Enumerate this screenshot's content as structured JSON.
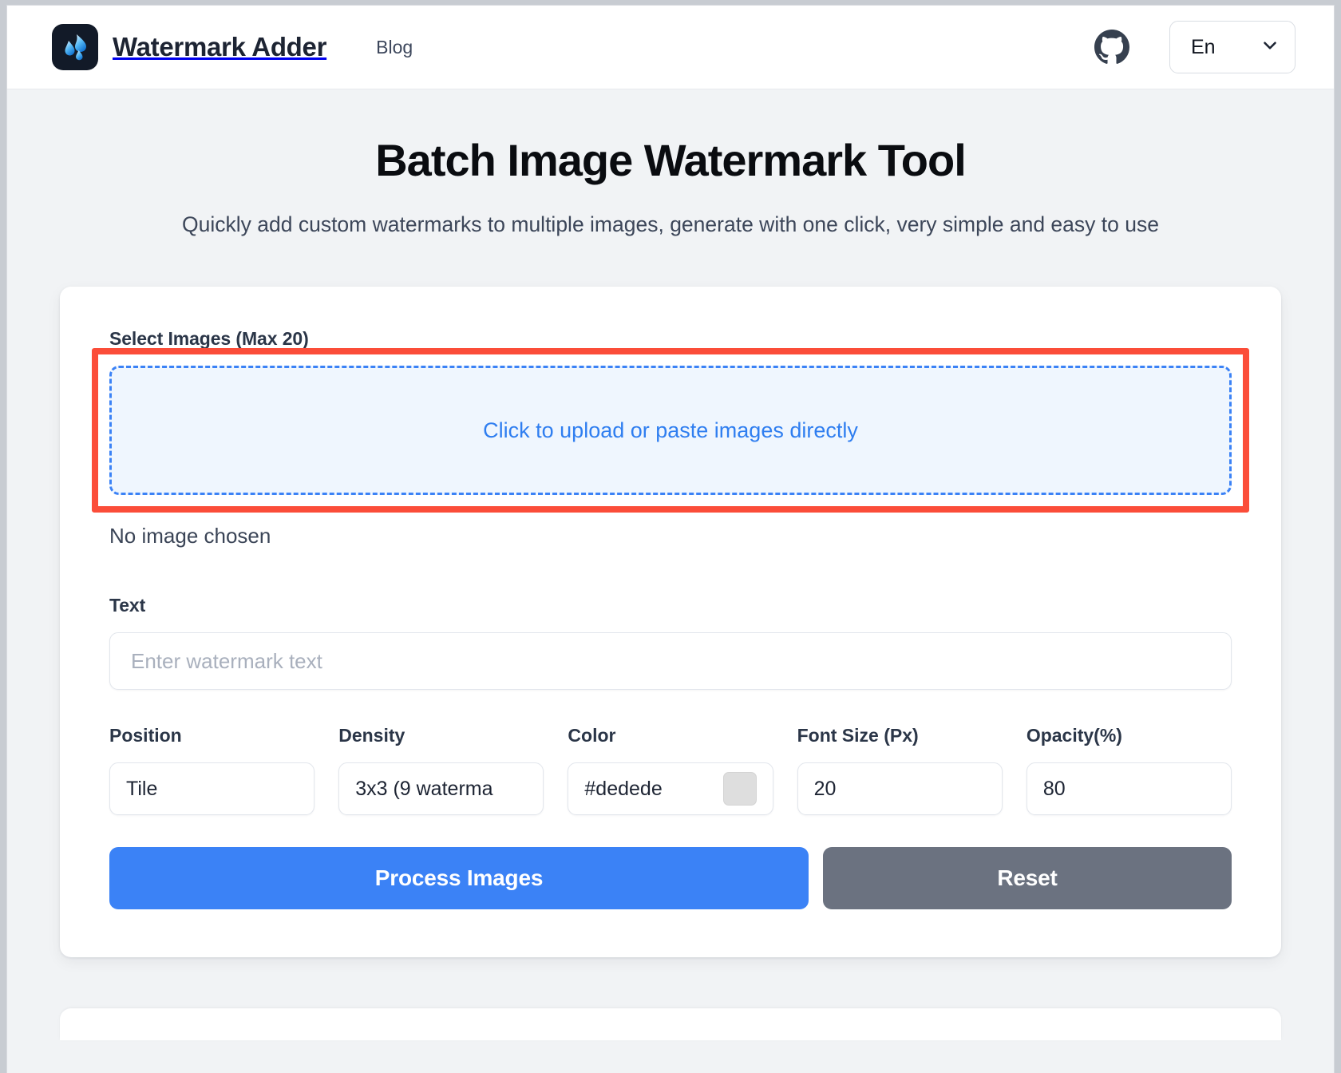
{
  "header": {
    "logo_icon": "water-droplets-logo",
    "brand_name": "Watermark Adder",
    "nav": [
      {
        "label": "Blog"
      }
    ],
    "github_icon": "github-icon",
    "language": {
      "value": "En",
      "chevron_icon": "chevron-down-icon"
    }
  },
  "hero": {
    "title": "Batch Image Watermark Tool",
    "subtitle": "Quickly add custom watermarks to multiple images, generate with one click, very simple and easy to use"
  },
  "form": {
    "upload": {
      "label": "Select Images (Max 20)",
      "dropzone_text": "Click to upload or paste images directly",
      "status": "No image chosen",
      "highlight_color": "#fb4d39"
    },
    "text": {
      "label": "Text",
      "value": "",
      "placeholder": "Enter watermark text"
    },
    "controls": [
      {
        "label": "Position",
        "value": "Tile",
        "type": "select"
      },
      {
        "label": "Density",
        "value": "3x3 (9 waterma",
        "type": "select"
      },
      {
        "label": "Color",
        "value": "#dedede",
        "type": "color",
        "swatch": "#dedede"
      },
      {
        "label": "Font Size (Px)",
        "value": "20",
        "type": "number"
      },
      {
        "label": "Opacity(%)",
        "value": "80",
        "type": "number"
      }
    ],
    "actions": {
      "process_label": "Process Images",
      "process_color": "#3b82f6",
      "reset_label": "Reset",
      "reset_color": "#6b7280"
    }
  }
}
